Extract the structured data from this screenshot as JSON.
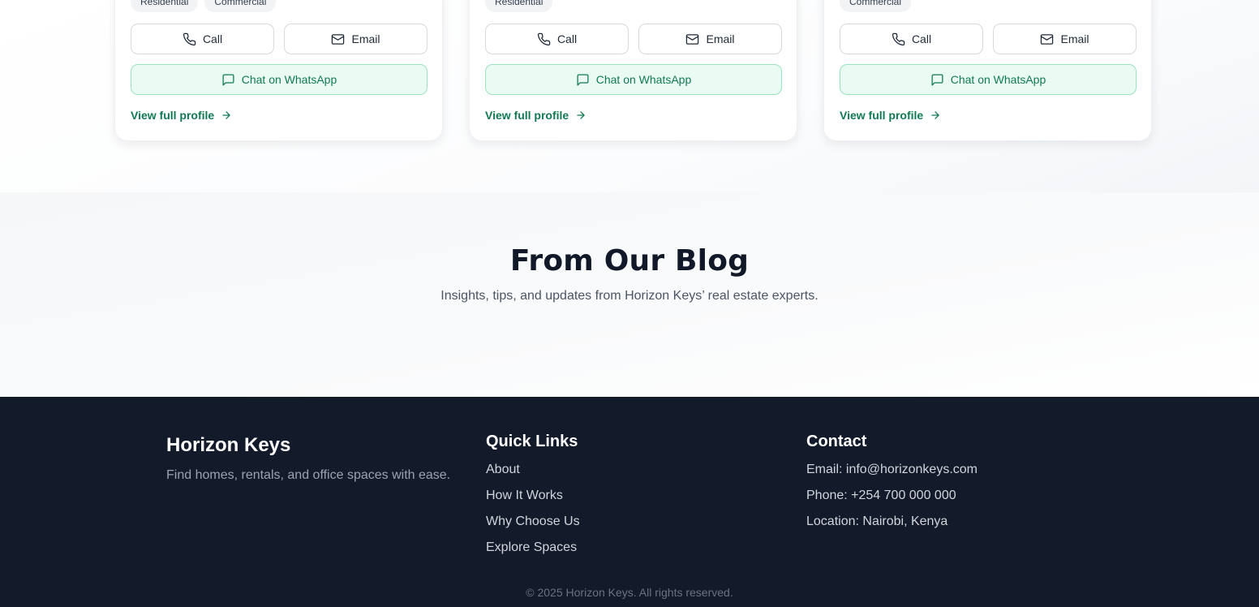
{
  "agents": [
    {
      "tags": [
        "Residential",
        "Commercial"
      ],
      "call_label": "Call",
      "email_label": "Email",
      "whatsapp_label": "Chat on WhatsApp",
      "profile_label": "View full profile"
    },
    {
      "tags": [
        "Residential"
      ],
      "call_label": "Call",
      "email_label": "Email",
      "whatsapp_label": "Chat on WhatsApp",
      "profile_label": "View full profile"
    },
    {
      "tags": [
        "Commercial"
      ],
      "call_label": "Call",
      "email_label": "Email",
      "whatsapp_label": "Chat on WhatsApp",
      "profile_label": "View full profile"
    }
  ],
  "blog": {
    "title": "From Our Blog",
    "subtitle": "Insights, tips, and updates from Horizon Keys’ real estate experts."
  },
  "footer": {
    "brand": "Horizon Keys",
    "tagline": "Find homes, rentals, and office spaces with ease.",
    "quick_links_title": "Quick Links",
    "quick_links": [
      "About",
      "How It Works",
      "Why Choose Us",
      "Explore Spaces"
    ],
    "contact_title": "Contact",
    "contact_items": [
      "Email: info@horizonkeys.com",
      "Phone: +254 700 000 000",
      "Location: Nairobi, Kenya"
    ],
    "copyright": "© 2025 Horizon Keys. All rights reserved."
  },
  "colors": {
    "accent_green": "#127a52",
    "whatsapp_bg": "#e9fbf2",
    "footer_bg": "#131a29"
  },
  "icons": {
    "call": "phone-icon",
    "email": "mail-icon",
    "whatsapp": "chat-bubble-icon",
    "profile": "arrow-right-icon"
  }
}
